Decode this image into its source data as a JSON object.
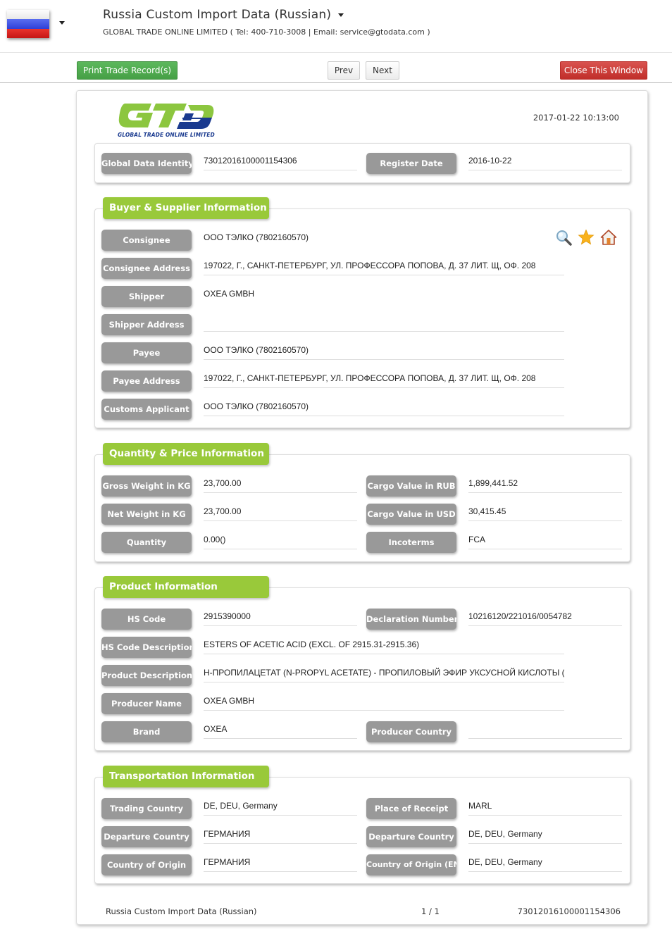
{
  "header": {
    "title": "Russia Custom Import Data (Russian)",
    "subtitle": "GLOBAL TRADE ONLINE LIMITED ( Tel: 400-710-3008 | Email: service@gtodata.com )",
    "flag_icon": "russia-flag-icon"
  },
  "toolbar": {
    "print_label": "Print Trade Record(s)",
    "prev_label": "Prev",
    "next_label": "Next",
    "close_label": "Close This Window"
  },
  "record": {
    "logo_text": "GLOBAL TRADE ONLINE LIMITED",
    "timestamp": "2017-01-22 10:13:00",
    "identity": {
      "global_data_identity_label": "Global Data Identity",
      "global_data_identity": "73012016100001154306",
      "register_date_label": "Register Date",
      "register_date": "2016-10-22"
    },
    "buyer_supplier": {
      "title": "Buyer & Supplier Information",
      "rows": [
        {
          "label": "Consignee",
          "value": "ООО ТЭЛКО (7802160570)"
        },
        {
          "label": "Consignee Address",
          "value": "197022, Г., САНКТ-ПЕТЕРБУРГ, УЛ. ПРОФЕССОРА ПОПОВА, Д. 37 ЛИТ. Щ, ОФ. 208"
        },
        {
          "label": "Shipper",
          "value": "OXEA GMBH"
        },
        {
          "label": "Shipper Address",
          "value": ""
        },
        {
          "label": "Payee",
          "value": "ООО ТЭЛКО  (7802160570)"
        },
        {
          "label": "Payee Address",
          "value": "197022, Г., САНКТ-ПЕТЕРБУРГ, УЛ. ПРОФЕССОРА ПОПОВА, Д. 37 ЛИТ. Щ, ОФ. 208"
        },
        {
          "label": "Customs Applicant",
          "value": "ООО ТЭЛКО  (7802160570)"
        }
      ]
    },
    "quantity_price": {
      "title": "Quantity & Price Information",
      "left": [
        {
          "label": "Gross Weight in KG",
          "value": "23,700.00"
        },
        {
          "label": "Net Weight in KG",
          "value": "23,700.00"
        },
        {
          "label": "Quantity",
          "value": "0.00()"
        }
      ],
      "right": [
        {
          "label": "Cargo Value in RUB",
          "value": "1,899,441.52"
        },
        {
          "label": "Cargo Value in USD",
          "value": "30,415.45"
        },
        {
          "label": "Incoterms",
          "value": "FCA"
        }
      ]
    },
    "product": {
      "title": "Product Information",
      "hs_code_label": "HS Code",
      "hs_code": "2915390000",
      "declaration_number_label": "Declaration Number",
      "declaration_number": "10216120/221016/0054782",
      "hs_desc_label": "HS Code Description",
      "hs_desc": "ESTERS OF ACETIC ACID (EXCL. OF 2915.31-2915.36)",
      "product_desc_label": "Product Description",
      "product_desc": "Н-ПРОПИЛАЦЕТАТ (N-PROPYL ACETATE) - ПРОПИЛОВЫЙ ЭФИР УКСУСНОЙ КИСЛОТЫ (",
      "producer_name_label": "Producer Name",
      "producer_name": "OXEA GMBH",
      "brand_label": "Brand",
      "brand": "OXEA",
      "producer_country_label": "Producer Country",
      "producer_country": ""
    },
    "transport": {
      "title": "Transportation Information",
      "left": [
        {
          "label": "Trading Country",
          "value": "DE, DEU, Germany"
        },
        {
          "label": "Departure Country",
          "value": "ГЕРМАНИЯ"
        },
        {
          "label": "Country of Origin",
          "value": "ГЕРМАНИЯ"
        }
      ],
      "right": [
        {
          "label": "Place of Receipt",
          "value": "MARL"
        },
        {
          "label": "Departure Country",
          "value": "DE, DEU, Germany"
        },
        {
          "label": "Country of Origin (EN)",
          "value": "DE, DEU, Germany"
        }
      ]
    },
    "footer": {
      "source": "Russia Custom Import Data (Russian)",
      "page": "1 / 1",
      "identity": "73012016100001154306"
    }
  },
  "colors": {
    "section_title_bg": "#99c93a",
    "label_bg": "#999999",
    "print_button": "#5cb85c",
    "close_button": "#d9534f",
    "logo_green": "#8cc63f",
    "logo_blue": "#1a3a8f"
  }
}
